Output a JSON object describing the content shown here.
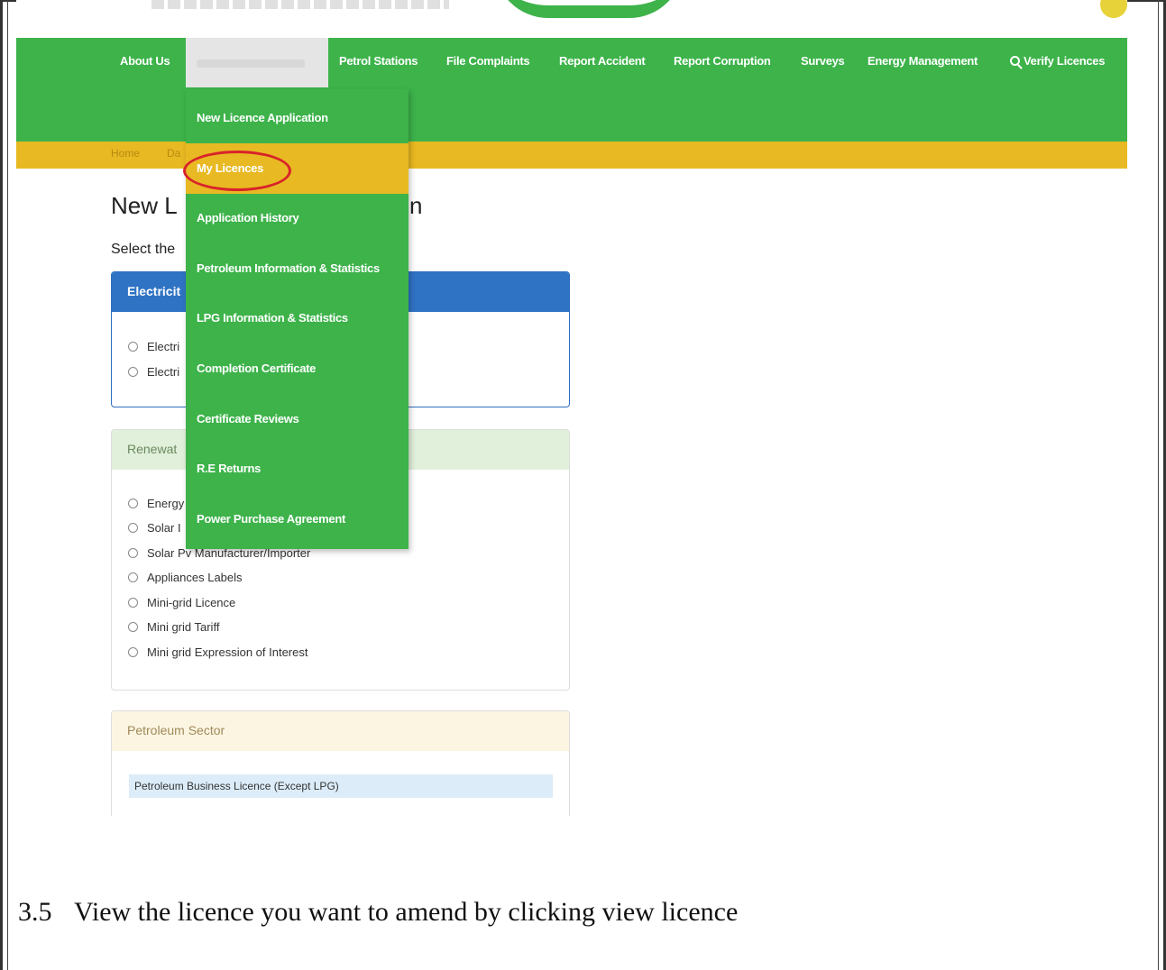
{
  "nav": {
    "items": [
      "About Us",
      "Petrol Stations",
      "File Complaints",
      "Report Accident",
      "Report Corruption",
      "Surveys",
      "Energy Management",
      "Verify Licences"
    ]
  },
  "breadcrumb": {
    "home": "Home",
    "partial": "Da"
  },
  "page": {
    "title_partial": "New L",
    "title_tail": "n",
    "select_partial": "Select the"
  },
  "dropdown": {
    "items": [
      "New Licence Application",
      "My Licences",
      "Application History",
      "Petroleum Information & Statistics",
      "LPG Information & Statistics",
      "Completion Certificate",
      "Certificate Reviews",
      "R.E Returns",
      "Power Purchase Agreement"
    ],
    "active_index": 1
  },
  "panels": {
    "electricity": {
      "title_partial": "Electricit",
      "options": [
        "Electri",
        "Electri"
      ]
    },
    "renewable": {
      "title_partial": "Renewat",
      "options": [
        "Energy",
        "Solar I",
        "Solar Pv Manufacturer/Importer",
        "Appliances Labels",
        "Mini-grid Licence",
        "Mini grid Tariff",
        "Mini grid Expression of Interest"
      ]
    },
    "petroleum": {
      "title": "Petroleum Sector",
      "first_item": "Petroleum Business Licence (Except LPG)"
    }
  },
  "caption": {
    "number": "3.5",
    "text": "View the licence you want to amend by clicking view licence"
  },
  "colors": {
    "nav_green": "#3db34a",
    "accent_yellow": "#e8b922",
    "electricity_blue": "#2f73c4",
    "highlight_red": "#d8232a"
  }
}
